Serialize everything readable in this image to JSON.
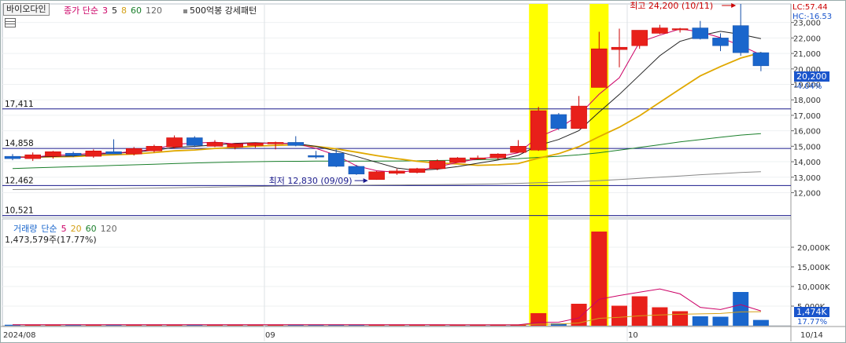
{
  "header": {
    "stock_name": "바이오다인",
    "price_legend": [
      {
        "text": "종가 단순",
        "color": "#cc0066"
      },
      {
        "text": "3",
        "color": "#cc0066"
      },
      {
        "text": "5",
        "color": "#222222"
      },
      {
        "text": "8",
        "color": "#d4a017"
      },
      {
        "text": "60",
        "color": "#1a7f2b"
      },
      {
        "text": "120",
        "color": "#666666"
      }
    ],
    "pattern_label": "500억봉 강세패턴",
    "lc_label": "LC:57.44",
    "hc_label": "HC:-16.53"
  },
  "volume_header": {
    "legend": [
      {
        "text": "거래량",
        "color": "#1a66cc"
      },
      {
        "text": "단순",
        "color": "#1a66cc"
      },
      {
        "text": "5",
        "color": "#cc0066"
      },
      {
        "text": "20",
        "color": "#d4a017"
      },
      {
        "text": "60",
        "color": "#1a7f2b"
      },
      {
        "text": "120",
        "color": "#666666"
      }
    ],
    "current_volume": "1,473,579주(17.77%)"
  },
  "price_axis_labels": [
    "23,000",
    "22,000",
    "21,000",
    "20,000",
    "19,000",
    "18,000",
    "17,000",
    "16,000",
    "15,000",
    "14,000",
    "13,000",
    "12,000"
  ],
  "volume_axis_labels": [
    "20,000K",
    "15,000K",
    "10,000K",
    "5,000K"
  ],
  "date_labels": [
    "2024/08",
    "09",
    "10",
    "10/14"
  ],
  "annotations": {
    "high": "최고 24,200 (10/11)",
    "low": "최저 12,830 (09/09)",
    "price_tag": "20,200",
    "change_pct": "-4.04%",
    "volume_tag": "1,474K",
    "volume_pct": "17.77%"
  },
  "levels": [
    {
      "label": "17,411",
      "price": 17411
    },
    {
      "label": "14,858",
      "price": 14858
    },
    {
      "label": "12,462",
      "price": 12462
    },
    {
      "label": "10,521",
      "price": 10521
    }
  ],
  "chart_data": {
    "type": "candlestick",
    "y_range": [
      10400,
      24200
    ],
    "volume_range_k": [
      0,
      24000
    ],
    "candles": [
      {
        "o": 14350,
        "h": 14500,
        "l": 14100,
        "c": 14200,
        "v": 250
      },
      {
        "o": 14200,
        "h": 14600,
        "l": 14050,
        "c": 14450,
        "v": 240
      },
      {
        "o": 14350,
        "h": 14700,
        "l": 14200,
        "c": 14650,
        "v": 260
      },
      {
        "o": 14550,
        "h": 14650,
        "l": 14300,
        "c": 14400,
        "v": 220
      },
      {
        "o": 14350,
        "h": 14800,
        "l": 14250,
        "c": 14700,
        "v": 230
      },
      {
        "o": 14650,
        "h": 15450,
        "l": 14500,
        "c": 14500,
        "v": 240
      },
      {
        "o": 14500,
        "h": 14950,
        "l": 14400,
        "c": 14850,
        "v": 250
      },
      {
        "o": 14700,
        "h": 15100,
        "l": 14600,
        "c": 15000,
        "v": 240
      },
      {
        "o": 14950,
        "h": 15700,
        "l": 14850,
        "c": 15550,
        "v": 280
      },
      {
        "o": 15550,
        "h": 15650,
        "l": 14950,
        "c": 15050,
        "v": 250
      },
      {
        "o": 15000,
        "h": 15400,
        "l": 14950,
        "c": 15250,
        "v": 230
      },
      {
        "o": 14950,
        "h": 15200,
        "l": 14800,
        "c": 15150,
        "v": 240
      },
      {
        "o": 15050,
        "h": 15250,
        "l": 14900,
        "c": 15200,
        "v": 230
      },
      {
        "o": 15150,
        "h": 15300,
        "l": 14800,
        "c": 15250,
        "v": 280
      },
      {
        "o": 15250,
        "h": 15650,
        "l": 15000,
        "c": 15050,
        "v": 260
      },
      {
        "o": 14400,
        "h": 14700,
        "l": 14200,
        "c": 14300,
        "v": 270
      },
      {
        "o": 14550,
        "h": 14800,
        "l": 13650,
        "c": 13700,
        "v": 280
      },
      {
        "o": 13700,
        "h": 13800,
        "l": 13150,
        "c": 13200,
        "v": 250
      },
      {
        "o": 12850,
        "h": 13400,
        "l": 12830,
        "c": 13350,
        "v": 240
      },
      {
        "o": 13250,
        "h": 13550,
        "l": 13150,
        "c": 13400,
        "v": 200
      },
      {
        "o": 13300,
        "h": 13600,
        "l": 13250,
        "c": 13550,
        "v": 220
      },
      {
        "o": 13550,
        "h": 14150,
        "l": 13450,
        "c": 14050,
        "v": 230
      },
      {
        "o": 13950,
        "h": 14300,
        "l": 13950,
        "c": 14250,
        "v": 210
      },
      {
        "o": 14250,
        "h": 14400,
        "l": 14150,
        "c": 14250,
        "v": 190
      },
      {
        "o": 14250,
        "h": 14550,
        "l": 14150,
        "c": 14500,
        "v": 210
      },
      {
        "o": 14600,
        "h": 15400,
        "l": 14600,
        "c": 15000,
        "v": 260
      },
      {
        "o": 14750,
        "h": 17550,
        "l": 14700,
        "c": 17300,
        "v": 3200
      },
      {
        "o": 17050,
        "h": 17150,
        "l": 16050,
        "c": 16150,
        "v": 600
      },
      {
        "o": 16150,
        "h": 18250,
        "l": 16150,
        "c": 17600,
        "v": 5600
      },
      {
        "o": 18800,
        "h": 22400,
        "l": 18800,
        "c": 21300,
        "v": 24000
      },
      {
        "o": 21250,
        "h": 22600,
        "l": 20100,
        "c": 21400,
        "v": 5100
      },
      {
        "o": 21500,
        "h": 22500,
        "l": 21300,
        "c": 22500,
        "v": 7500
      },
      {
        "o": 22300,
        "h": 22850,
        "l": 22250,
        "c": 22650,
        "v": 4700
      },
      {
        "o": 22550,
        "h": 22650,
        "l": 22350,
        "c": 22600,
        "v": 3700
      },
      {
        "o": 22650,
        "h": 23100,
        "l": 21900,
        "c": 21950,
        "v": 2400
      },
      {
        "o": 22000,
        "h": 22300,
        "l": 21150,
        "c": 21500,
        "v": 2300
      },
      {
        "o": 22800,
        "h": 24200,
        "l": 20850,
        "c": 21050,
        "v": 8600
      },
      {
        "o": 21050,
        "h": 21100,
        "l": 19850,
        "c": 20200,
        "v": 1474
      }
    ],
    "ma3": [
      14300,
      14280,
      14433,
      14433,
      14583,
      14533,
      14683,
      14783,
      15133,
      15200,
      15267,
      15150,
      15200,
      15200,
      15167,
      14867,
      14417,
      13733,
      13417,
      13317,
      13433,
      13667,
      13950,
      14183,
      14333,
      14583,
      15600,
      16150,
      17017,
      18367,
      19433,
      21733,
      22183,
      22583,
      22400,
      22017,
      21500,
      20917
    ],
    "ma5": [
      14300,
      14290,
      14333,
      14375,
      14480,
      14540,
      14620,
      14740,
      14920,
      14990,
      15080,
      15190,
      15230,
      15180,
      15180,
      14990,
      14700,
      14340,
      13960,
      13590,
      13440,
      13520,
      13690,
      13900,
      14110,
      14410,
      15060,
      15440,
      16010,
      17210,
      18350,
      19600,
      20850,
      21780,
      22150,
      22430,
      22230,
      21960
    ],
    "ma8": [
      14300,
      14300,
      14320,
      14330,
      14400,
      14450,
      14500,
      14590,
      14700,
      14760,
      14860,
      14930,
      15010,
      15060,
      15100,
      14990,
      14830,
      14620,
      14400,
      14200,
      14030,
      13910,
      13860,
      13770,
      13800,
      13880,
      14230,
      14520,
      14970,
      15620,
      16230,
      16970,
      17840,
      18700,
      19550,
      20150,
      20700,
      21050
    ],
    "ma60": [
      13560,
      13600,
      13640,
      13680,
      13720,
      13760,
      13800,
      13840,
      13880,
      13920,
      13950,
      13980,
      14000,
      14020,
      14030,
      14040,
      14040,
      14040,
      14040,
      14050,
      14060,
      14080,
      14100,
      14130,
      14160,
      14200,
      14280,
      14350,
      14450,
      14580,
      14750,
      14920,
      15100,
      15280,
      15430,
      15580,
      15720,
      15820
    ],
    "ma120": [
      12200,
      12210,
      12220,
      12230,
      12250,
      12260,
      12280,
      12300,
      12320,
      12340,
      12360,
      12380,
      12400,
      12420,
      12440,
      12460,
      12470,
      12480,
      12490,
      12500,
      12510,
      12520,
      12530,
      12550,
      12570,
      12600,
      12640,
      12680,
      12720,
      12780,
      12850,
      12920,
      13000,
      13080,
      13160,
      13230,
      13300,
      13360
    ],
    "vma5": [
      240,
      245,
      245,
      245,
      245,
      248,
      246,
      250,
      255,
      255,
      250,
      250,
      248,
      250,
      255,
      255,
      265,
      262,
      258,
      248,
      240,
      236,
      230,
      215,
      210,
      230,
      820,
      900,
      1980,
      6740,
      7700,
      8560,
      9370,
      8120,
      4680,
      4120,
      5380,
      3780
    ],
    "vma20": [
      240,
      240,
      240,
      240,
      240,
      240,
      245,
      245,
      245,
      245,
      245,
      245,
      245,
      248,
      248,
      250,
      252,
      252,
      250,
      250,
      248,
      248,
      246,
      244,
      242,
      240,
      400,
      430,
      700,
      1900,
      2150,
      2520,
      2740,
      2930,
      3030,
      3120,
      3520,
      3570
    ],
    "highlight_candles": [
      26,
      29
    ]
  }
}
